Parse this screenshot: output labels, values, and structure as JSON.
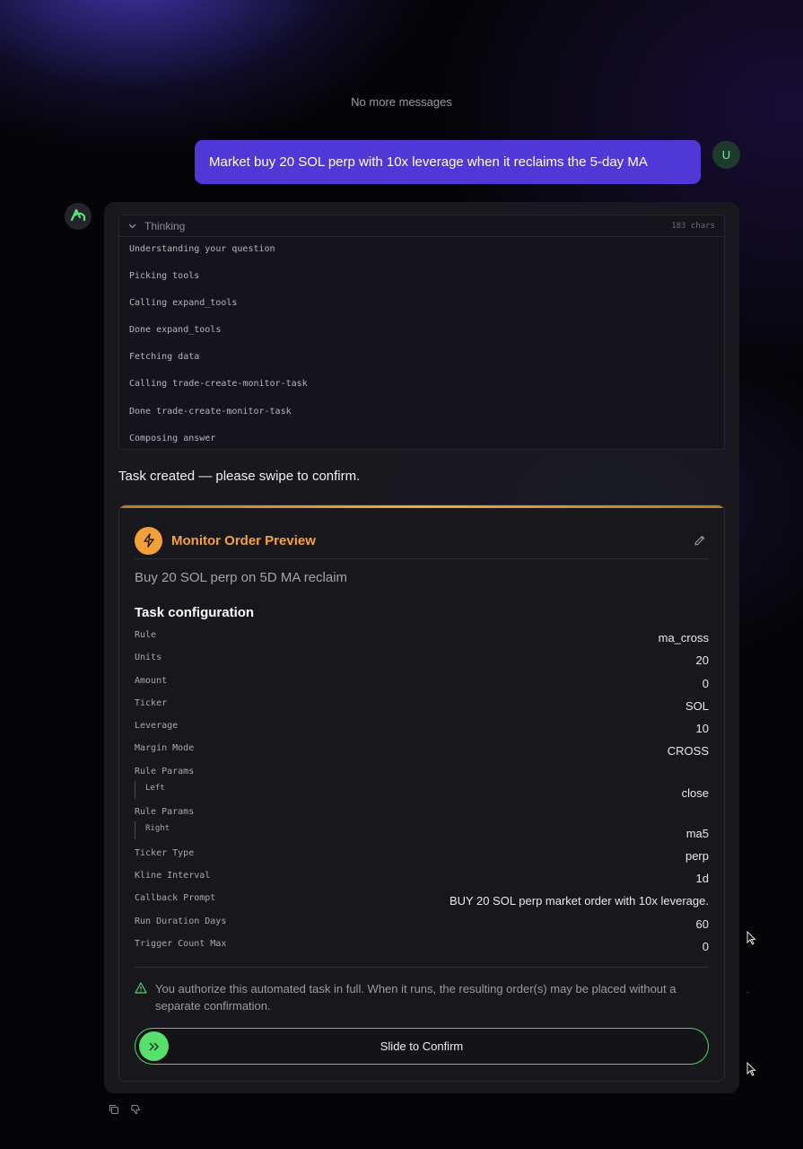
{
  "chat": {
    "no_more_messages": "No more messages",
    "user_message": "Market buy 20 SOL perp with 10x leverage when it reclaims the 5-day MA",
    "user_avatar_initial": "U"
  },
  "thinking": {
    "label": "Thinking",
    "char_count": "183 chars",
    "steps": [
      "Understanding your question",
      "Picking tools",
      "Calling expand_tools",
      "Done expand_tools",
      "Fetching data",
      "Calling trade-create-monitor-task",
      "Done trade-create-monitor-task",
      "Composing answer"
    ]
  },
  "answer": {
    "text": "Task created — please swipe to confirm."
  },
  "order_preview": {
    "title": "Monitor Order Preview",
    "subtitle": "Buy 20 SOL perp on 5D MA reclaim",
    "config_heading": "Task configuration",
    "rows": [
      {
        "key": "Rule",
        "value": "ma_cross"
      },
      {
        "key": "Units",
        "value": "20"
      },
      {
        "key": "Amount",
        "value": "0"
      },
      {
        "key": "Ticker",
        "value": "SOL"
      },
      {
        "key": "Leverage",
        "value": "10"
      },
      {
        "key": "Margin Mode",
        "value": "CROSS"
      },
      {
        "key": "Rule Params",
        "sub": "Left",
        "value": "close"
      },
      {
        "key": "Rule Params",
        "sub": "Right",
        "value": "ma5"
      },
      {
        "key": "Ticker Type",
        "value": "perp"
      },
      {
        "key": "Kline Interval",
        "value": "1d"
      },
      {
        "key": "Callback Prompt",
        "value": "BUY 20 SOL perp market order with 10x leverage."
      },
      {
        "key": "Run Duration Days",
        "value": "60"
      },
      {
        "key": "Trigger Count Max",
        "value": "0"
      }
    ],
    "notice": "You authorize this automated task in full. When it runs, the resulting order(s) may be placed without a separate confirmation.",
    "slide_label": "Slide to Confirm"
  },
  "icons": {
    "bot_avatar": "logo-icon",
    "collapse": "chevron-down-icon",
    "order": "bolt-icon",
    "edit": "pencil-icon",
    "warning": "warning-icon",
    "slider_knob": "double-chevron-right-icon",
    "copy": "copy-icon",
    "dislike": "thumbs-down-icon"
  },
  "colors": {
    "user_bubble": "#4f38d6",
    "accent_orange": "#f4a340",
    "accent_green": "#58e06e"
  }
}
